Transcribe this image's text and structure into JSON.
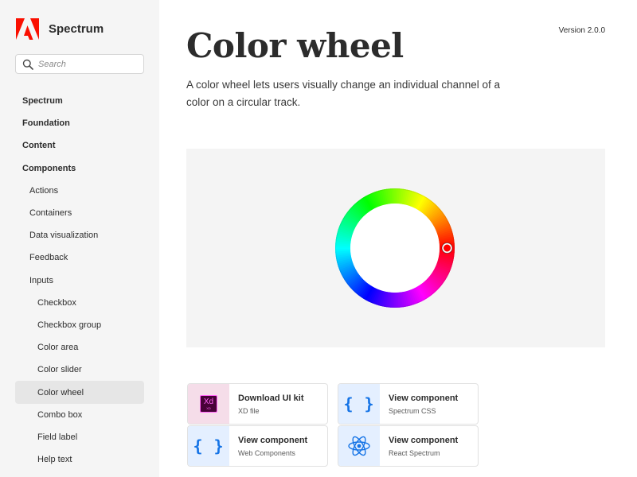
{
  "app": {
    "name": "Spectrum",
    "logo_icon": "adobe-logo-icon",
    "accent_color": "#fa0f00"
  },
  "search": {
    "placeholder": "Search",
    "value": "",
    "icon": "search-icon"
  },
  "sidebar": {
    "items": [
      {
        "label": "Spectrum",
        "level": 0,
        "selected": false
      },
      {
        "label": "Foundation",
        "level": 0,
        "selected": false
      },
      {
        "label": "Content",
        "level": 0,
        "selected": false
      },
      {
        "label": "Components",
        "level": 0,
        "selected": false
      },
      {
        "label": "Actions",
        "level": 1,
        "selected": false
      },
      {
        "label": "Containers",
        "level": 1,
        "selected": false
      },
      {
        "label": "Data visualization",
        "level": 1,
        "selected": false
      },
      {
        "label": "Feedback",
        "level": 1,
        "selected": false
      },
      {
        "label": "Inputs",
        "level": 1,
        "selected": false
      },
      {
        "label": "Checkbox",
        "level": 2,
        "selected": false
      },
      {
        "label": "Checkbox group",
        "level": 2,
        "selected": false
      },
      {
        "label": "Color area",
        "level": 2,
        "selected": false
      },
      {
        "label": "Color slider",
        "level": 2,
        "selected": false
      },
      {
        "label": "Color wheel",
        "level": 2,
        "selected": true
      },
      {
        "label": "Combo box",
        "level": 2,
        "selected": false
      },
      {
        "label": "Field label",
        "level": 2,
        "selected": false
      },
      {
        "label": "Help text",
        "level": 2,
        "selected": false
      }
    ]
  },
  "header": {
    "version": "Version 2.0.0",
    "title": "Color wheel",
    "description": "A color wheel lets users visually change an individual channel of a color on a circular track."
  },
  "preview": {
    "background": "#f4f4f4",
    "selected_hue_degrees": 0,
    "selected_color": "#ff0000"
  },
  "resources": [
    {
      "title": "Download UI kit",
      "subtitle": "XD file",
      "icon": "adobe-xd-icon",
      "icon_text": "Xd",
      "icon_caption": "XD",
      "icon_bg": "#f5dde9"
    },
    {
      "title": "View component",
      "subtitle": "Spectrum CSS",
      "icon": "css-braces-icon",
      "icon_text": "{ }",
      "icon_bg": "#e4efff"
    },
    {
      "title": "View component",
      "subtitle": "Web Components",
      "icon": "web-components-braces-icon",
      "icon_text": "{ }",
      "icon_bg": "#e4efff"
    },
    {
      "title": "View component",
      "subtitle": "React Spectrum",
      "icon": "react-icon",
      "icon_bg": "#e4efff"
    }
  ]
}
